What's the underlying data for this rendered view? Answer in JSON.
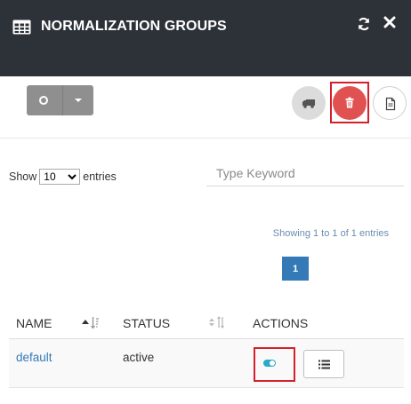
{
  "header": {
    "title": "NORMALIZATION GROUPS",
    "icons": [
      "grid-icon",
      "refresh-icon",
      "close-icon"
    ]
  },
  "toolbar": {
    "split_button_icon": "circle-icon",
    "action_icons": [
      "truck-icon",
      "trash-icon",
      "document-icon"
    ],
    "colors": {
      "delete": "#e05252",
      "highlight": "#d3202a",
      "header_bg": "#2d3238"
    }
  },
  "table_controls": {
    "show_label": "Show",
    "entries_value": "10",
    "entries_label": "entries",
    "search_placeholder": "Type Keyword",
    "info_text": "Showing 1 to 1 of 1 entries",
    "current_page": "1"
  },
  "table": {
    "columns": [
      {
        "label": "NAME"
      },
      {
        "label": "STATUS"
      },
      {
        "label": "ACTIONS"
      }
    ],
    "rows": [
      {
        "name": "default",
        "status": "active",
        "enabled": true
      }
    ]
  }
}
